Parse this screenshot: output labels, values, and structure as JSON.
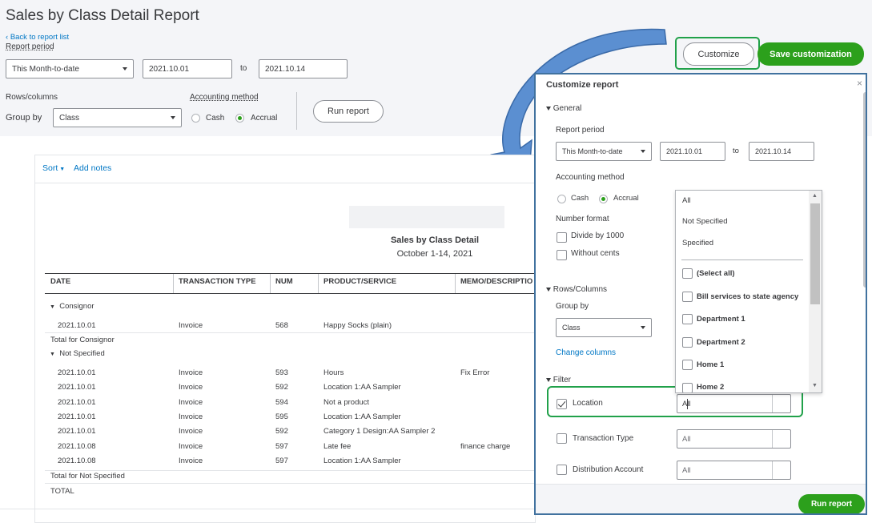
{
  "page_title": "Sales by Class Detail Report",
  "back_link": "Back to report list",
  "report_period_label": "Report period",
  "report_period_value": "This Month-to-date",
  "date_from": "2021.10.01",
  "to_label": "to",
  "date_to": "2021.10.14",
  "rows_columns_label": "Rows/columns",
  "accounting_method_label": "Accounting method",
  "group_by_label": "Group by",
  "group_by_value": "Class",
  "cash_label": "Cash",
  "accrual_label": "Accrual",
  "run_report_label": "Run report",
  "customize_label": "Customize",
  "save_customization_label": "Save customization",
  "sort_label": "Sort",
  "add_notes_label": "Add notes",
  "report": {
    "title": "Sales by Class Detail",
    "subtitle": "October 1-14, 2021",
    "columns": [
      "DATE",
      "TRANSACTION TYPE",
      "NUM",
      "PRODUCT/SERVICE",
      "MEMO/DESCRIPTIO"
    ],
    "group1": "Consignor",
    "group1_rows": [
      {
        "date": "2021.10.01",
        "type": "Invoice",
        "num": "568",
        "product": "Happy Socks (plain)",
        "memo": ""
      }
    ],
    "group1_total": "Total for Consignor",
    "group2": "Not Specified",
    "group2_rows": [
      {
        "date": "2021.10.01",
        "type": "Invoice",
        "num": "593",
        "product": "Hours",
        "memo": "Fix Error"
      },
      {
        "date": "2021.10.01",
        "type": "Invoice",
        "num": "592",
        "product": "Location 1:AA Sampler",
        "memo": ""
      },
      {
        "date": "2021.10.01",
        "type": "Invoice",
        "num": "594",
        "product": "Not a product",
        "memo": ""
      },
      {
        "date": "2021.10.01",
        "type": "Invoice",
        "num": "595",
        "product": "Location 1:AA Sampler",
        "memo": ""
      },
      {
        "date": "2021.10.01",
        "type": "Invoice",
        "num": "592",
        "product": "Category 1 Design:AA Sampler 2",
        "memo": ""
      },
      {
        "date": "2021.10.08",
        "type": "Invoice",
        "num": "597",
        "product": "Late fee",
        "memo": "finance charge"
      },
      {
        "date": "2021.10.08",
        "type": "Invoice",
        "num": "597",
        "product": "Location 1:AA Sampler",
        "memo": ""
      }
    ],
    "group2_total": "Total for Not Specified",
    "grand_total": "TOTAL"
  },
  "panel": {
    "title": "Customize report",
    "general": "General",
    "report_period_label": "Report period",
    "report_period_value": "This Month-to-date",
    "date_from": "2021.10.01",
    "to_label": "to",
    "date_to": "2021.10.14",
    "accounting_method_label": "Accounting method",
    "cash_label": "Cash",
    "accrual_label": "Accrual",
    "number_format_label": "Number format",
    "divide_label": "Divide by 1000",
    "without_cents_label": "Without cents",
    "rows_columns": "Rows/Columns",
    "group_by_label": "Group by",
    "group_by_value": "Class",
    "change_columns": "Change columns",
    "filter": "Filter",
    "location_label": "Location",
    "location_value": "All",
    "transaction_type_label": "Transaction Type",
    "transaction_type_value": "All",
    "distribution_account_label": "Distribution Account",
    "distribution_account_value": "All",
    "run_report_label": "Run report"
  },
  "dropdown": {
    "options": [
      "All",
      "Not Specified",
      "Specified"
    ],
    "checkbox_items": [
      "(Select all)",
      "Bill services to state agency",
      "Department 1",
      "Department 2",
      "Home 1",
      "Home 2"
    ]
  },
  "colors": {
    "accent_green": "#2ca01c",
    "link_blue": "#0077c5",
    "highlight_green": "#21a14a",
    "panel_border": "#41729f",
    "arrow_blue": "#5b8fd1"
  }
}
